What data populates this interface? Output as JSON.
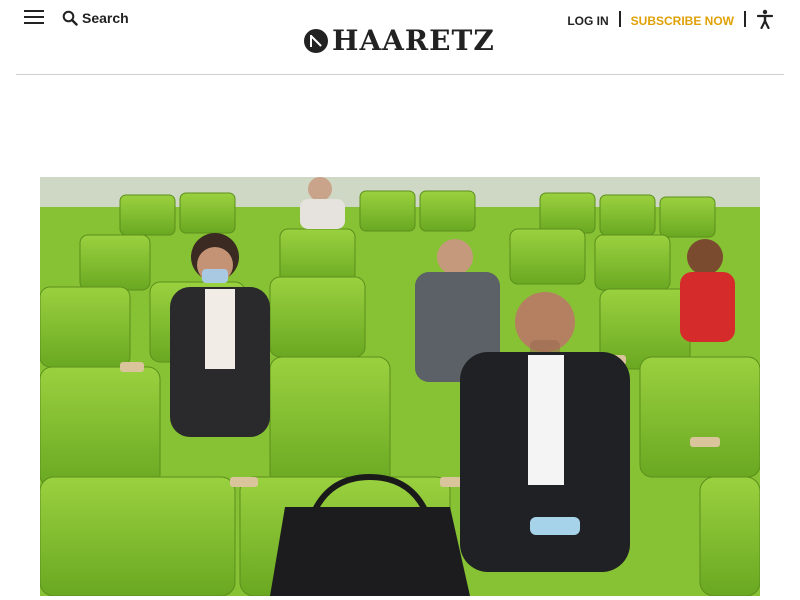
{
  "header": {
    "search_label": "Search",
    "logo_text": "HAARETZ",
    "login_label": "LOG IN",
    "subscribe_label": "SUBSCRIBE NOW"
  },
  "icons": {
    "menu": "hamburger-menu-icon",
    "search": "search-icon",
    "logo_mark": "haaretz-logo-mark",
    "accessibility": "accessibility-icon"
  },
  "colors": {
    "text": "#222222",
    "subscribe": "#e0a106",
    "divider": "#cfcfcf",
    "seat_green": "#7dbb2e"
  },
  "hero": {
    "description_visible": false
  }
}
